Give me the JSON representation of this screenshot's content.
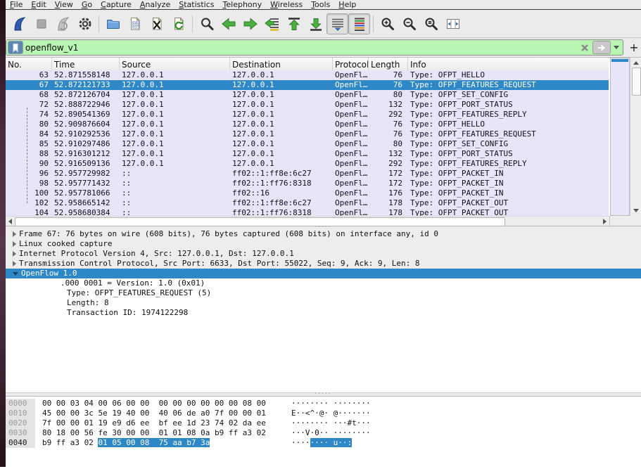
{
  "menu_bar": {
    "items": [
      "File",
      "Edit",
      "View",
      "Go",
      "Capture",
      "Analyze",
      "Statistics",
      "Telephony",
      "Wireless",
      "Tools",
      "Help"
    ]
  },
  "toolbar": {
    "icons": [
      "wireshark-start-capture",
      "stop-capture",
      "restart-capture",
      "capture-options",
      "open-file",
      "save-file",
      "close-file",
      "reload-file",
      "find-packet",
      "go-back",
      "go-forward",
      "go-to-packet",
      "go-to-top",
      "go-to-bottom",
      "auto-scroll-toggle",
      "colorize-toggle",
      "zoom-in",
      "zoom-out",
      "zoom-original",
      "resize-columns"
    ]
  },
  "filter_bar": {
    "value": "openflow_v1",
    "status_color": "#b8f4b2",
    "add_label": "+"
  },
  "packet_list": {
    "selection_color": "#2e87c6",
    "row_color": "#e7e6f9",
    "columns": [
      {
        "key": "no",
        "label": "No."
      },
      {
        "key": "time",
        "label": "Time"
      },
      {
        "key": "source",
        "label": "Source"
      },
      {
        "key": "destination",
        "label": "Destination"
      },
      {
        "key": "protocol",
        "label": "Protocol"
      },
      {
        "key": "length",
        "label": "Length"
      },
      {
        "key": "info",
        "label": "Info"
      }
    ],
    "rows": [
      {
        "no": "63",
        "time": "52.871558148",
        "source": "127.0.0.1",
        "destination": "127.0.0.1",
        "protocol": "OpenFlow",
        "length": "76",
        "info": "Type: OFPT_HELLO",
        "selected": false
      },
      {
        "no": "67",
        "time": "52.872121733",
        "source": "127.0.0.1",
        "destination": "127.0.0.1",
        "protocol": "OpenFlow",
        "length": "76",
        "info": "Type: OFPT_FEATURES_REQUEST",
        "selected": true
      },
      {
        "no": "68",
        "time": "52.872126704",
        "source": "127.0.0.1",
        "destination": "127.0.0.1",
        "protocol": "OpenFlow",
        "length": "80",
        "info": "Type: OFPT_SET_CONFIG",
        "selected": false
      },
      {
        "no": "72",
        "time": "52.888722946",
        "source": "127.0.0.1",
        "destination": "127.0.0.1",
        "protocol": "OpenFlow",
        "length": "132",
        "info": "Type: OFPT_PORT_STATUS",
        "selected": false
      },
      {
        "no": "74",
        "time": "52.890541369",
        "source": "127.0.0.1",
        "destination": "127.0.0.1",
        "protocol": "OpenFlow",
        "length": "292",
        "info": "Type: OFPT_FEATURES_REPLY",
        "selected": false
      },
      {
        "no": "80",
        "time": "52.909876604",
        "source": "127.0.0.1",
        "destination": "127.0.0.1",
        "protocol": "OpenFlow",
        "length": "76",
        "info": "Type: OFPT_HELLO",
        "selected": false
      },
      {
        "no": "84",
        "time": "52.910292536",
        "source": "127.0.0.1",
        "destination": "127.0.0.1",
        "protocol": "OpenFlow",
        "length": "76",
        "info": "Type: OFPT_FEATURES_REQUEST",
        "selected": false
      },
      {
        "no": "85",
        "time": "52.910297486",
        "source": "127.0.0.1",
        "destination": "127.0.0.1",
        "protocol": "OpenFlow",
        "length": "80",
        "info": "Type: OFPT_SET_CONFIG",
        "selected": false
      },
      {
        "no": "88",
        "time": "52.916301212",
        "source": "127.0.0.1",
        "destination": "127.0.0.1",
        "protocol": "OpenFlow",
        "length": "132",
        "info": "Type: OFPT_PORT_STATUS",
        "selected": false
      },
      {
        "no": "90",
        "time": "52.916509136",
        "source": "127.0.0.1",
        "destination": "127.0.0.1",
        "protocol": "OpenFlow",
        "length": "292",
        "info": "Type: OFPT_FEATURES_REPLY",
        "selected": false
      },
      {
        "no": "96",
        "time": "52.957729982",
        "source": "::",
        "destination": "ff02::1:ff8e:6c27",
        "protocol": "OpenFlow",
        "length": "172",
        "info": "Type: OFPT_PACKET_IN",
        "selected": false
      },
      {
        "no": "98",
        "time": "52.957771432",
        "source": "::",
        "destination": "ff02::1:ff76:8318",
        "protocol": "OpenFlow",
        "length": "172",
        "info": "Type: OFPT_PACKET_IN",
        "selected": false
      },
      {
        "no": "100",
        "time": "52.957781066",
        "source": "::",
        "destination": "ff02::16",
        "protocol": "OpenFlow",
        "length": "176",
        "info": "Type: OFPT_PACKET_IN",
        "selected": false
      },
      {
        "no": "102",
        "time": "52.958665142",
        "source": "::",
        "destination": "ff02::1:ff8e:6c27",
        "protocol": "OpenFlow",
        "length": "178",
        "info": "Type: OFPT_PACKET_OUT",
        "selected": false
      },
      {
        "no": "104",
        "time": "52.958680384",
        "source": "::",
        "destination": "ff02::1:ff76:8318",
        "protocol": "OpenFlow",
        "length": "178",
        "info": "Type: OFPT_PACKET_OUT",
        "selected": false
      }
    ]
  },
  "detail_pane": {
    "rows": [
      {
        "expander": "closed",
        "level": 0,
        "shaded": true,
        "selected": false,
        "text": "Frame 67: 76 bytes on wire (608 bits), 76 bytes captured (608 bits) on interface any, id 0"
      },
      {
        "expander": "closed",
        "level": 0,
        "shaded": true,
        "selected": false,
        "text": "Linux cooked capture"
      },
      {
        "expander": "closed",
        "level": 0,
        "shaded": true,
        "selected": false,
        "text": "Internet Protocol Version 4, Src: 127.0.0.1, Dst: 127.0.0.1"
      },
      {
        "expander": "closed",
        "level": 0,
        "shaded": true,
        "selected": false,
        "text": "Transmission Control Protocol, Src Port: 6633, Dst Port: 55022, Seq: 9, Ack: 9, Len: 8"
      },
      {
        "expander": "open",
        "level": 0,
        "shaded": false,
        "selected": true,
        "text": "OpenFlow 1.0"
      },
      {
        "level": 1,
        "bitfield": true,
        "shaded": false,
        "selected": false,
        "text": ".000 0001 = Version: 1.0 (0x01)"
      },
      {
        "level": 1,
        "shaded": false,
        "selected": false,
        "text": "Type: OFPT_FEATURES_REQUEST (5)"
      },
      {
        "level": 1,
        "shaded": false,
        "selected": false,
        "text": "Length: 8"
      },
      {
        "level": 1,
        "shaded": false,
        "selected": false,
        "text": "Transaction ID: 1974122298"
      }
    ]
  },
  "hex_pane": {
    "rows": [
      {
        "addr": "0000",
        "addr_selected": false,
        "hex": "00 00 03 04 00 06 00 00  00 00 00 00 00 00 08 00",
        "hex_hl": "",
        "ascii": "········ ········",
        "ascii_hl": ""
      },
      {
        "addr": "0010",
        "addr_selected": false,
        "hex": "45 00 00 3c 5e 19 40 00  40 06 de a0 7f 00 00 01",
        "hex_hl": "",
        "ascii": "E··<^·@· @·······",
        "ascii_hl": ""
      },
      {
        "addr": "0020",
        "addr_selected": false,
        "hex": "7f 00 00 01 19 e9 d6 ee  bf ee 1d 23 74 02 da ee",
        "hex_hl": "",
        "ascii": "········ ···#t···",
        "ascii_hl": ""
      },
      {
        "addr": "0030",
        "addr_selected": false,
        "hex": "80 18 00 56 fe 30 00 00  01 01 08 0a b9 ff a3 02",
        "hex_hl": "",
        "ascii": "···V·0·· ········",
        "ascii_hl": ""
      },
      {
        "addr": "0040",
        "addr_selected": true,
        "hex": "b9 ff a3 02 ",
        "hex_hl": "01 05 00 08  75 aa b7 3a",
        "ascii": "····",
        "ascii_hl": "···· u··:"
      }
    ]
  }
}
